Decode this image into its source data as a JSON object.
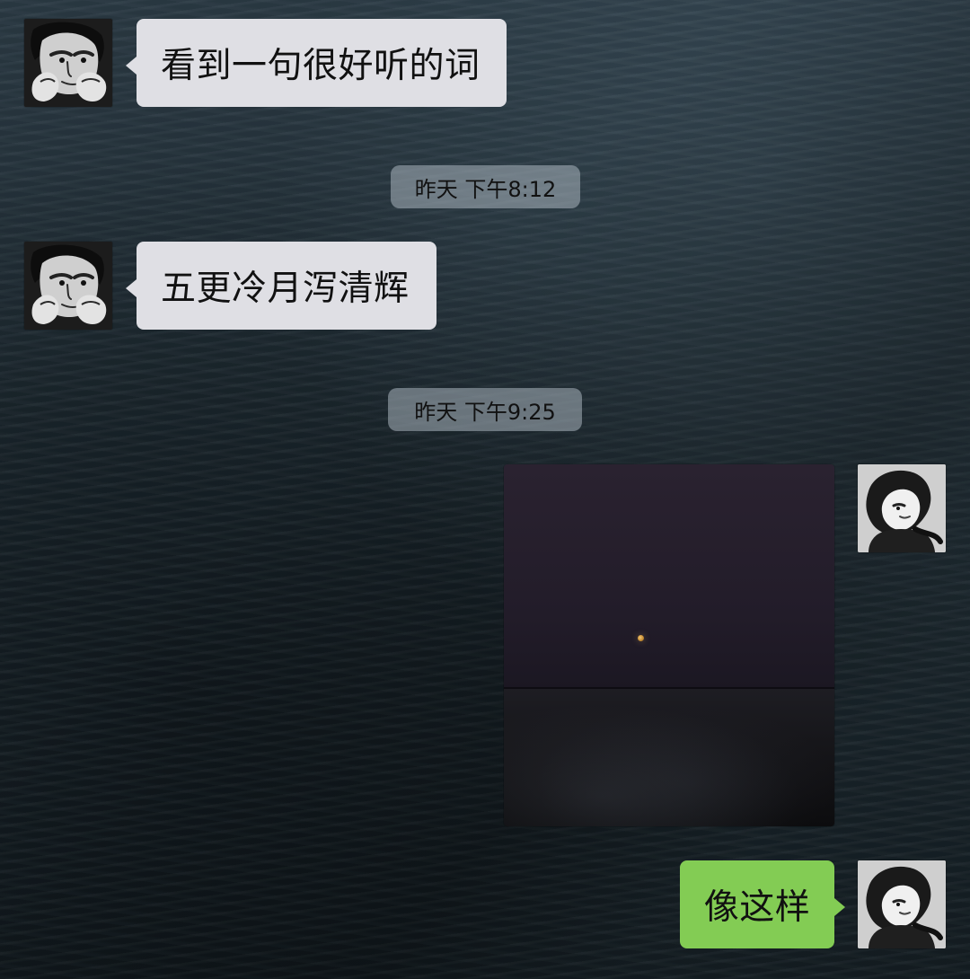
{
  "messages": [
    {
      "text": "看到一句很好听的词"
    },
    {
      "text": "五更冷月泻清辉"
    },
    {
      "text": "像这样"
    }
  ],
  "timestamps": [
    {
      "text": "昨天 下午8:12"
    },
    {
      "text": "昨天 下午9:25"
    }
  ],
  "colors": {
    "incoming_bubble": "#dfdfe4",
    "outgoing_bubble": "#83cc54"
  },
  "icons": {
    "contact_avatar": "man-portrait-avatar-icon",
    "self_avatar": "woman-portrait-avatar-icon"
  }
}
